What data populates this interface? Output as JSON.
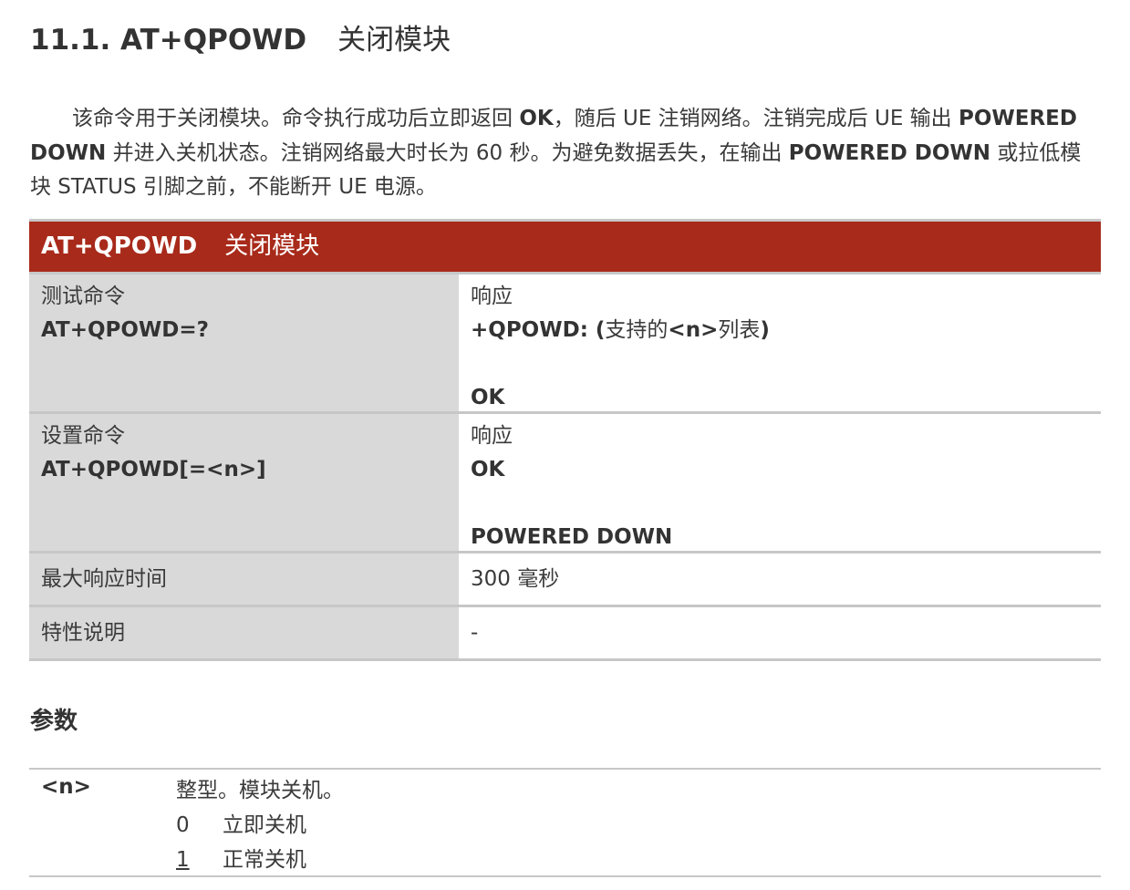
{
  "title": {
    "number": "11.1. AT+QPOWD",
    "name": "关闭模块"
  },
  "intro": {
    "s1": "该命令用于关闭模块。命令执行成功后立即返回 ",
    "b1": "OK",
    "s2": "，随后 UE 注销网络。注销完成后 UE 输出 ",
    "b2": "POWERED DOWN",
    "s3": " 并进入关机状态。注销网络最大时长为 60 秒。为避免数据丢失，在输出 ",
    "b3": "POWERED DOWN",
    "s4": " 或拉低模块 STATUS 引脚之前，不能断开 UE 电源。"
  },
  "command_table": {
    "header_cmd": "AT+QPOWD",
    "header_name": "关闭模块",
    "rows": [
      {
        "left_label": "测试命令",
        "left_cmd": "AT+QPOWD=?",
        "right_label": "响应",
        "right_line1_bold_a": "+QPOWD: (",
        "right_line1_text": "支持的",
        "right_line1_bold_b": "<n>",
        "right_line1_text2": "列表",
        "right_line1_bold_c": ")",
        "right_final": "OK"
      },
      {
        "left_label": "设置命令",
        "left_cmd": "AT+QPOWD[=<n>]",
        "right_label": "响应",
        "right_line1": "OK",
        "right_final": "POWERED DOWN"
      },
      {
        "left_label": "最大响应时间",
        "right_value": "300 毫秒"
      },
      {
        "left_label": "特性说明",
        "right_value": "-"
      }
    ]
  },
  "params_section": {
    "heading": "参数",
    "param_name": "<n>",
    "param_desc": "整型。模块关机。",
    "options": [
      {
        "value": "0",
        "label": "立即关机",
        "default": false
      },
      {
        "value": "1",
        "label": "正常关机",
        "default": true
      }
    ]
  }
}
